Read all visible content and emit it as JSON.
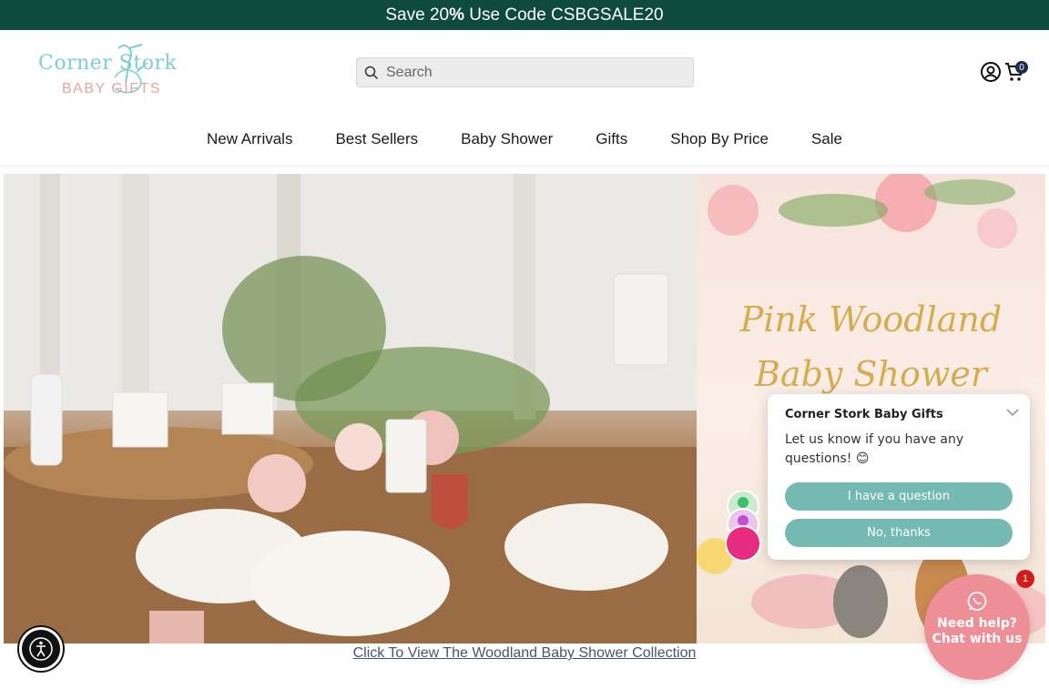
{
  "promo": {
    "prefix": "Save 20",
    "percent": "%",
    "suffix": " Use Code CSBGSALE20"
  },
  "brand": {
    "name_top": "Corner Stork",
    "name_bottom": "BABY GIFTS"
  },
  "search": {
    "placeholder": "Search"
  },
  "cart": {
    "count": "0"
  },
  "nav": {
    "items": [
      {
        "label": "New Arrivals"
      },
      {
        "label": "Best Sellers"
      },
      {
        "label": "Baby Shower"
      },
      {
        "label": "Gifts"
      },
      {
        "label": "Shop By Price"
      },
      {
        "label": "Sale"
      }
    ]
  },
  "hero": {
    "title_line1": "Pink Woodland",
    "title_line2": "Baby Shower",
    "link": "Click To View The Woodland Baby Shower Collection"
  },
  "chat": {
    "brand": "Corner Stork Baby Gifts",
    "message": "Let us know if you have any questions! 😊",
    "button_question": "I have a question",
    "button_no": "No, thanks",
    "launcher_text": "Need help? Chat with us",
    "badge": "1"
  },
  "colors": {
    "topbar": "#0f4a3e",
    "chat_button": "#74b9b2",
    "launcher": "#ee8e97",
    "hero_title": "#d4ac52"
  },
  "icons": [
    "search-icon",
    "account-icon",
    "cart-icon",
    "accessibility-icon",
    "chevron-down-icon",
    "whatsapp-icon"
  ]
}
